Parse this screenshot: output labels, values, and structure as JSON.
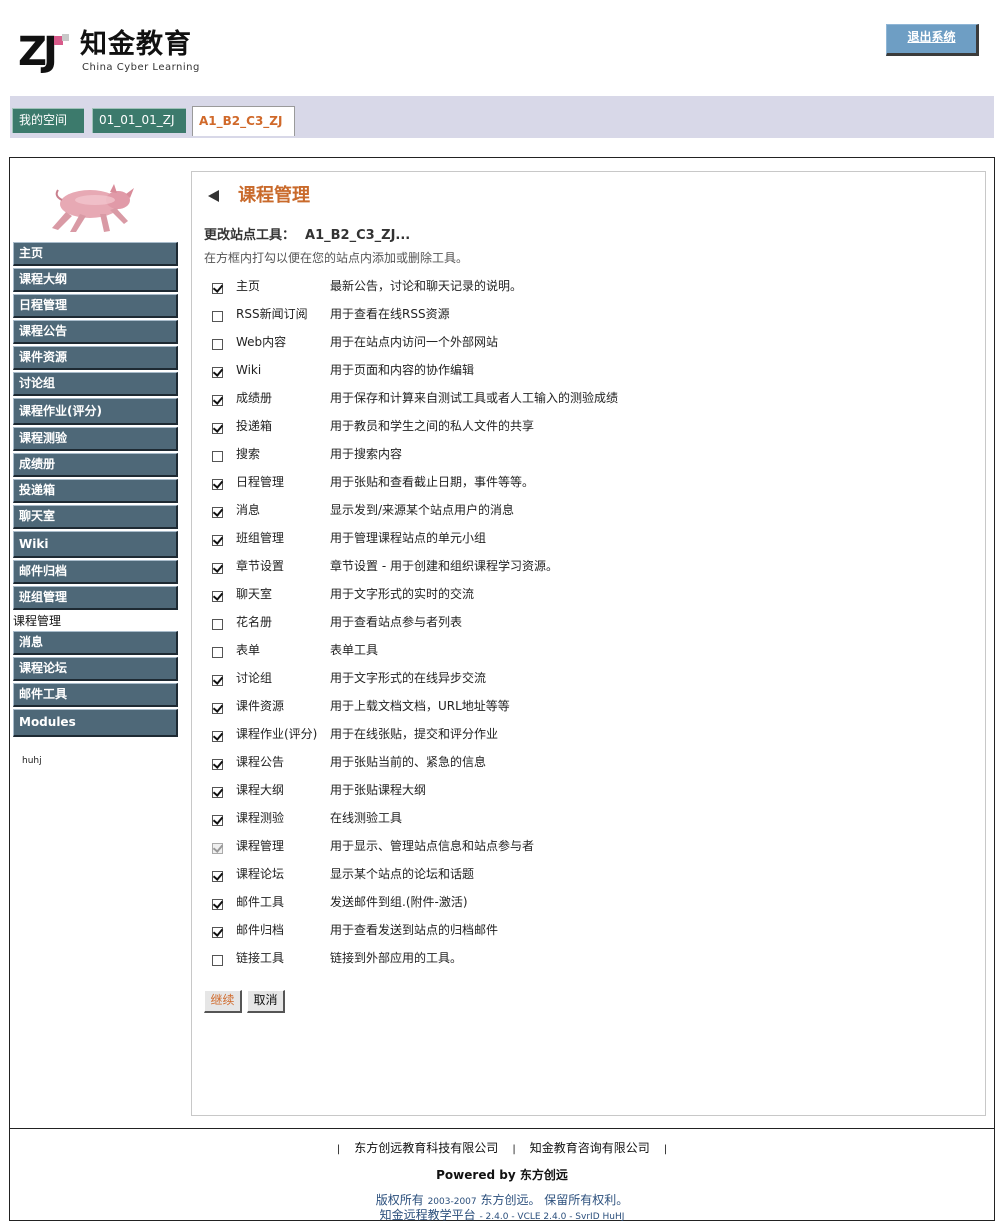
{
  "header": {
    "logo_cn": "知金教育",
    "logo_en": "China Cyber Learning",
    "logout_label": "退出系统"
  },
  "tabs": [
    {
      "label": "我的空间"
    },
    {
      "label": "01_01_01_ZJ"
    },
    {
      "label": "A1_B2_C3_ZJ"
    }
  ],
  "sidebar": {
    "items": [
      {
        "label": "主页"
      },
      {
        "label": "课程大纲"
      },
      {
        "label": "日程管理"
      },
      {
        "label": "课程公告"
      },
      {
        "label": "课件资源"
      },
      {
        "label": "讨论组"
      },
      {
        "label": "课程作业(评分)"
      },
      {
        "label": "课程测验"
      },
      {
        "label": "成绩册"
      },
      {
        "label": "投递箱"
      },
      {
        "label": "聊天室"
      },
      {
        "label": "Wiki"
      },
      {
        "label": "邮件归档"
      },
      {
        "label": "班组管理"
      }
    ],
    "current": "课程管理",
    "items_after": [
      {
        "label": "消息"
      },
      {
        "label": "课程论坛"
      },
      {
        "label": "邮件工具"
      },
      {
        "label": "Modules"
      }
    ],
    "user": "huhj"
  },
  "main": {
    "title": "课程管理",
    "subheading_label": "更改站点工具：",
    "site_name": "A1_B2_C3_ZJ...",
    "instructions": "在方框内打勾以便在您的站点内添加或删除工具。",
    "tools": [
      {
        "name": "主页",
        "desc": "最新公告，讨论和聊天记录的说明。",
        "checked": true
      },
      {
        "name": "RSS新闻订阅",
        "desc": "用于查看在线RSS资源",
        "checked": false
      },
      {
        "name": "Web内容",
        "desc": "用于在站点内访问一个外部网站",
        "checked": false
      },
      {
        "name": "Wiki",
        "desc": "用于页面和内容的协作编辑",
        "checked": true
      },
      {
        "name": "成绩册",
        "desc": "用于保存和计算来自测试工具或者人工输入的测验成绩",
        "checked": true
      },
      {
        "name": "投递箱",
        "desc": "用于教员和学生之间的私人文件的共享",
        "checked": true
      },
      {
        "name": "搜索",
        "desc": "用于搜索内容",
        "checked": false
      },
      {
        "name": "日程管理",
        "desc": "用于张贴和查看截止日期，事件等等。",
        "checked": true
      },
      {
        "name": "消息",
        "desc": "显示发到/来源某个站点用户的消息",
        "checked": true
      },
      {
        "name": "班组管理",
        "desc": "用于管理课程站点的单元小组",
        "checked": true
      },
      {
        "name": "章节设置",
        "desc": "章节设置 - 用于创建和组织课程学习资源。",
        "checked": true
      },
      {
        "name": "聊天室",
        "desc": "用于文字形式的实时的交流",
        "checked": true
      },
      {
        "name": "花名册",
        "desc": "用于查看站点参与者列表",
        "checked": false
      },
      {
        "name": "表单",
        "desc": "表单工具",
        "checked": false
      },
      {
        "name": "讨论组",
        "desc": "用于文字形式的在线异步交流",
        "checked": true
      },
      {
        "name": "课件资源",
        "desc": "用于上载文档文档，URL地址等等",
        "checked": true
      },
      {
        "name": "课程作业(评分)",
        "desc": "用于在线张贴，提交和评分作业",
        "checked": true
      },
      {
        "name": "课程公告",
        "desc": "用于张贴当前的、紧急的信息",
        "checked": true
      },
      {
        "name": "课程大纲",
        "desc": "用于张贴课程大纲",
        "checked": true
      },
      {
        "name": "课程测验",
        "desc": "在线测验工具",
        "checked": true
      },
      {
        "name": "课程管理",
        "desc": "用于显示、管理站点信息和站点参与者",
        "checked": true,
        "disabled": true
      },
      {
        "name": "课程论坛",
        "desc": "显示某个站点的论坛和话题",
        "checked": true
      },
      {
        "name": "邮件工具",
        "desc": "发送邮件到组.(附件-激活)",
        "checked": true
      },
      {
        "name": "邮件归档",
        "desc": "用于查看发送到站点的归档邮件",
        "checked": true
      },
      {
        "name": "链接工具",
        "desc": "链接到外部应用的工具。",
        "checked": false
      }
    ],
    "continue_label": "继续",
    "cancel_label": "取消"
  },
  "footer": {
    "link1": "东方创远教育科技有限公司",
    "link2": "知金教育咨询有限公司",
    "powered_prefix": "Powered by ",
    "powered_brand": "东方创远",
    "copy_prefix": "版权所有",
    "copy_years": "2003-2007",
    "copy_suffix": "东方创远。 保留所有权利。",
    "platform": "知金远程教学平台",
    "version": "- 2.4.0 - VCLE 2.4.0 - SvrID HuHJ"
  }
}
